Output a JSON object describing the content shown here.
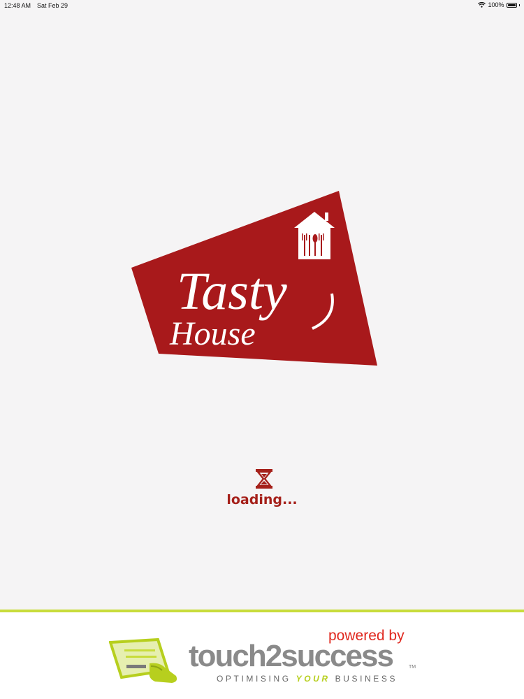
{
  "status_bar": {
    "time": "12:48 AM",
    "date": "Sat Feb 29",
    "battery": "100%"
  },
  "splash": {
    "logo_word_1": "Tasty",
    "logo_word_2": "House",
    "loading_text": "loading..."
  },
  "footer": {
    "powered_by": "powered by",
    "brand": "touch2success",
    "trademark": "TM",
    "tagline_pre": "OPTIMISING ",
    "tagline_highlight": "YOUR",
    "tagline_post": " BUSINESS"
  },
  "colors": {
    "brand_red": "#a8191b",
    "loading_red": "#a5201a",
    "footer_accent": "#c8dc3c",
    "powered_by_red": "#e0281f"
  }
}
